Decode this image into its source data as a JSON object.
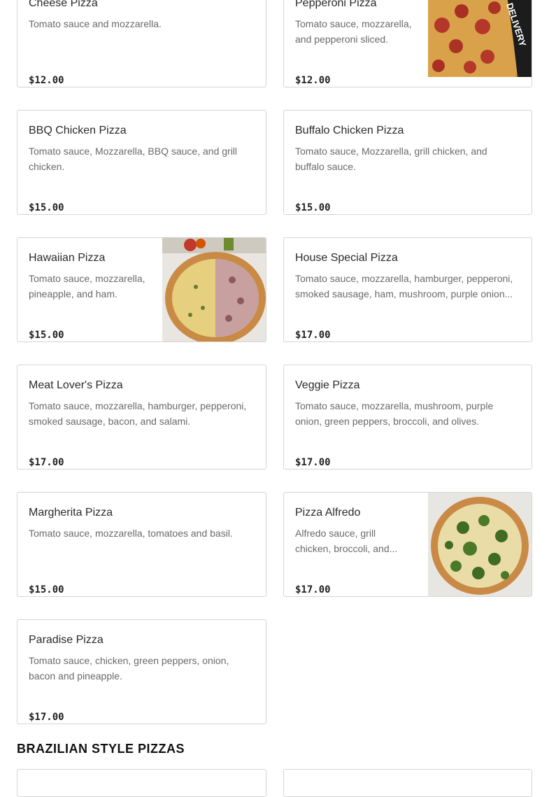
{
  "menu": {
    "items": [
      {
        "name": "Cheese Pizza",
        "description": "Tomato sauce and mozzarella.",
        "price": "$12.00"
      },
      {
        "name": "Pepperoni Pizza",
        "description": "Tomato sauce, mozzarella, and pepperoni sliced.",
        "price": "$12.00",
        "image_text": "DELIVERY"
      },
      {
        "name": "BBQ Chicken Pizza",
        "description": "Tomato sauce, Mozzarella, BBQ sauce, and grill chicken.",
        "price": "$15.00"
      },
      {
        "name": "Buffalo Chicken Pizza",
        "description": "Tomato sauce, Mozzarella, grill chicken, and buffalo sauce.",
        "price": "$15.00"
      },
      {
        "name": "Hawaiian Pizza",
        "description": "Tomato sauce, mozzarella, pineapple, and ham.",
        "price": "$15.00"
      },
      {
        "name": "House Special Pizza",
        "description": "Tomato sauce, mozzarella, hamburger, pepperoni, smoked sausage, ham, mushroom, purple onion...",
        "price": "$17.00"
      },
      {
        "name": "Meat Lover's Pizza",
        "description": "Tomato sauce, mozzarella, hamburger, pepperoni, smoked sausage, bacon, and salami.",
        "price": "$17.00"
      },
      {
        "name": "Veggie Pizza",
        "description": "Tomato sauce, mozzarella, mushroom, purple onion, green peppers, broccoli, and olives.",
        "price": "$17.00"
      },
      {
        "name": "Margherita Pizza",
        "description": "Tomato sauce, mozzarella, tomatoes and basil.",
        "price": "$15.00"
      },
      {
        "name": "Pizza Alfredo",
        "description": "Alfredo sauce, grill chicken, broccoli, and...",
        "price": "$17.00"
      },
      {
        "name": "Paradise Pizza",
        "description": "Tomato sauce, chicken, green peppers, onion, bacon and pineapple.",
        "price": "$17.00"
      }
    ],
    "next_section_title": "BRAZILIAN STYLE PIZZAS"
  }
}
